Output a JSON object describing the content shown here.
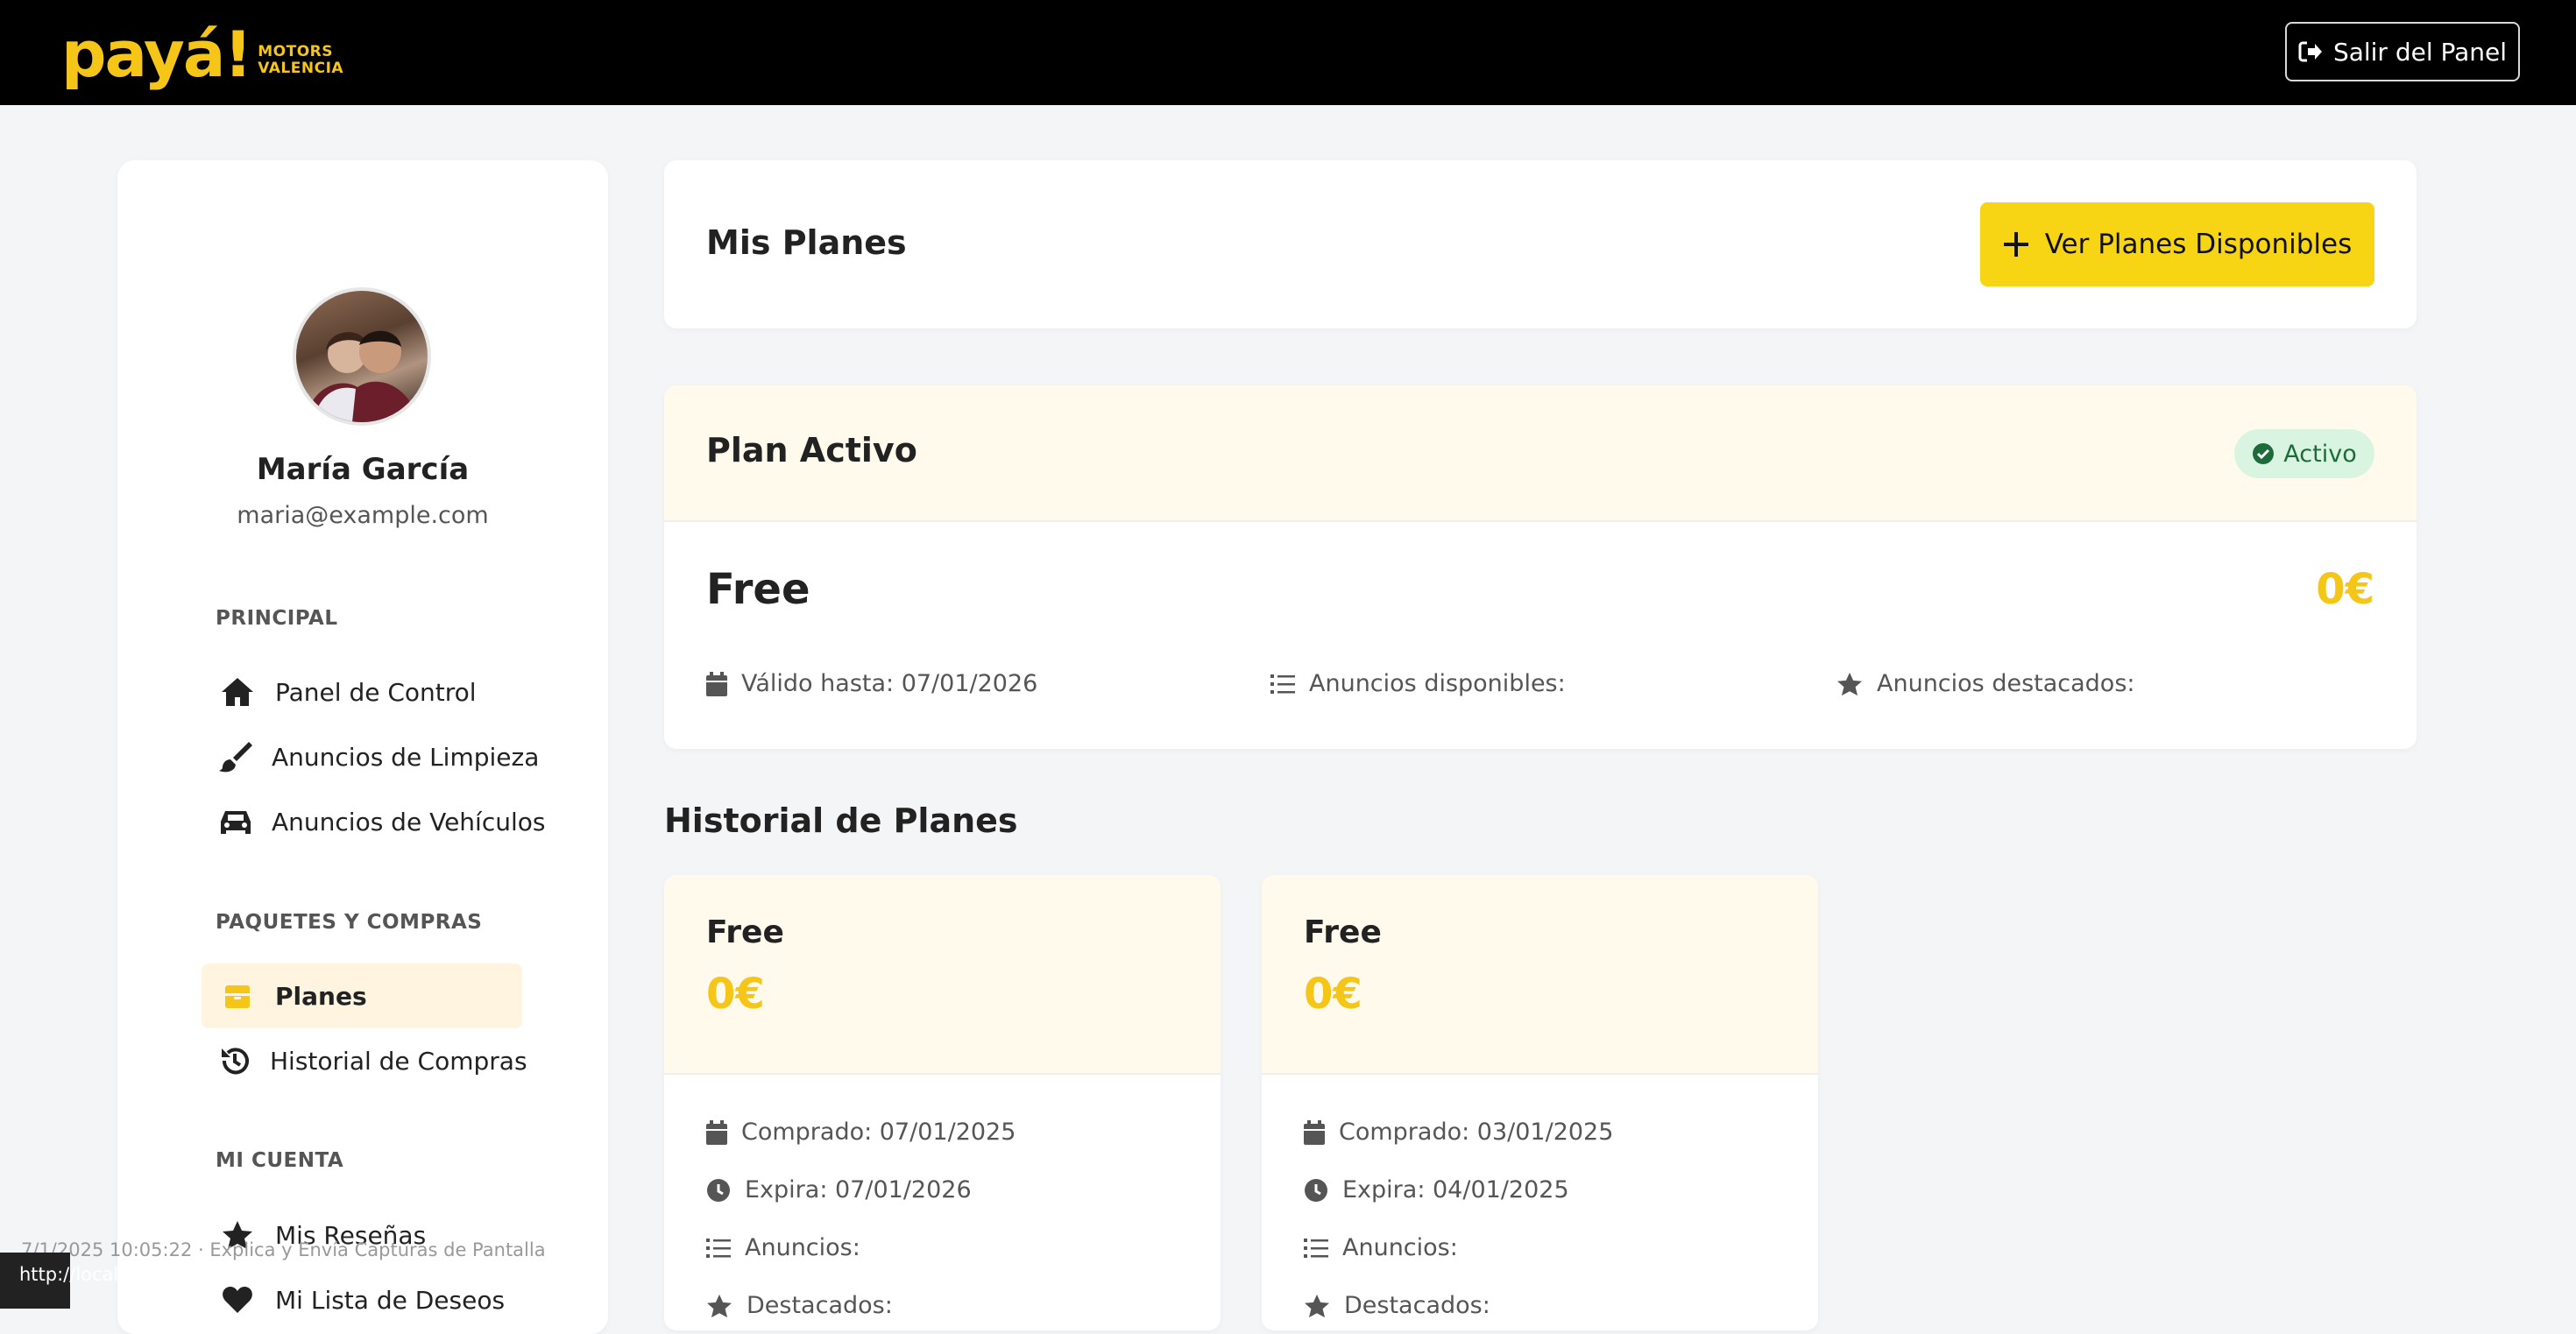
{
  "header": {
    "logo_text": "payá!",
    "logo_sub_line1": "MOTORS",
    "logo_sub_line2": "VALENCIA",
    "logout_label": "Salir del Panel"
  },
  "sidebar": {
    "user_name": "María García",
    "user_email": "maria@example.com",
    "sections": [
      {
        "title": "PRINCIPAL",
        "items": [
          {
            "label": "Panel de Control",
            "icon": "home-icon"
          },
          {
            "label": "Anuncios de Limpieza",
            "icon": "brush-icon"
          },
          {
            "label": "Anuncios de Vehículos",
            "icon": "car-icon"
          }
        ]
      },
      {
        "title": "PAQUETES Y COMPRAS",
        "items": [
          {
            "label": "Planes",
            "icon": "box-icon",
            "active": true
          },
          {
            "label": "Historial de Compras",
            "icon": "history-icon"
          }
        ]
      },
      {
        "title": "MI CUENTA",
        "items": [
          {
            "label": "Mis Reseñas",
            "icon": "star-icon"
          },
          {
            "label": "Mi Lista de Deseos",
            "icon": "heart-icon"
          }
        ]
      }
    ]
  },
  "main": {
    "title": "Mis Planes",
    "view_plans_label": "Ver Planes Disponibles",
    "active_plan": {
      "section_title": "Plan Activo",
      "status": "Activo",
      "name": "Free",
      "price": "0€",
      "valid_until": "Válido hasta: 07/01/2026",
      "ads_available": "Anuncios disponibles:",
      "featured_ads": "Anuncios destacados:"
    },
    "history_title": "Historial de Planes",
    "history": [
      {
        "name": "Free",
        "price": "0€",
        "purchased": "Comprado: 07/01/2025",
        "expires": "Expira: 07/01/2026",
        "ads": "Anuncios:",
        "featured": "Destacados:"
      },
      {
        "name": "Free",
        "price": "0€",
        "purchased": "Comprado: 03/01/2025",
        "expires": "Expira: 04/01/2025",
        "ads": "Anuncios:",
        "featured": "Destacados:"
      }
    ]
  },
  "overlay": {
    "timestamp": "7/1/2025 10:05:22 · Explica y Envía Capturas de Pantalla",
    "url": "http://localhost:3000/user/my-packages"
  },
  "colors": {
    "accent": "#f7d414",
    "price": "#f5c518",
    "active_bg": "#fff4e0",
    "badge_bg": "#d9f5e2"
  }
}
